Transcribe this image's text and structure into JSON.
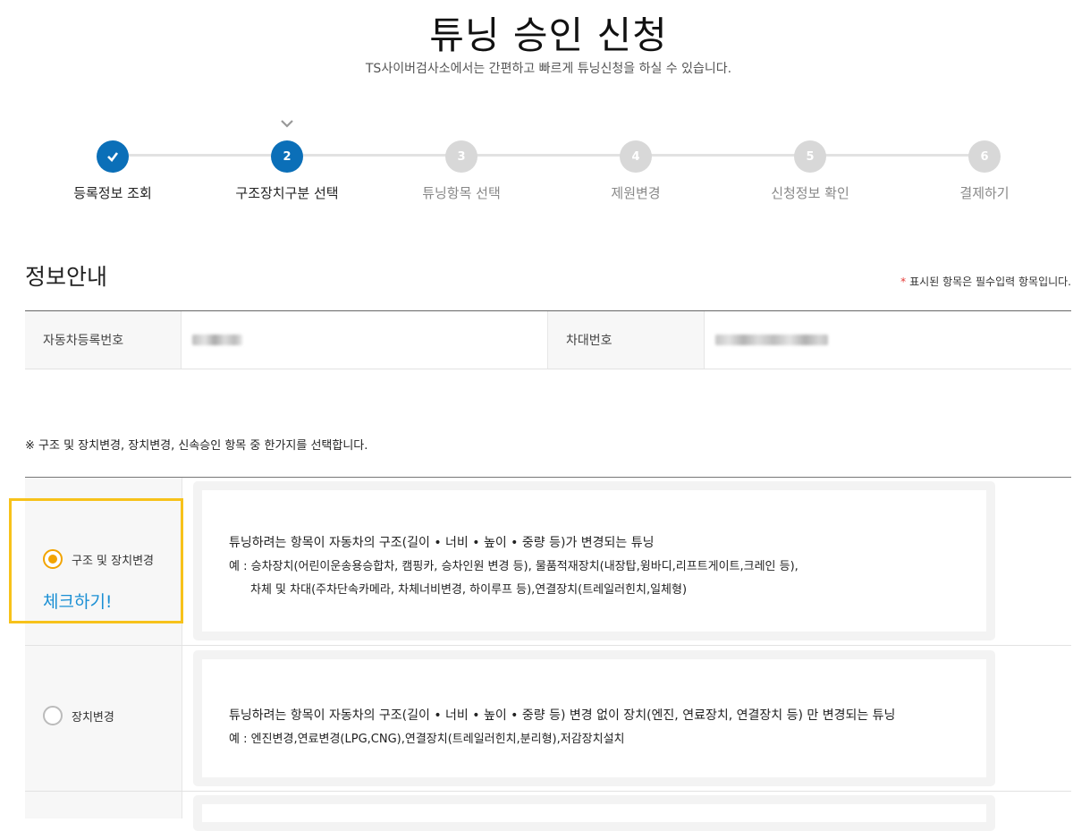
{
  "page": {
    "title": "튜닝 승인 신청",
    "subtitle": "TS사이버검사소에서는 간편하고 빠르게 튜닝신청을 하실 수 있습니다."
  },
  "stepper": {
    "current_step": 2,
    "steps": [
      {
        "number": "",
        "label": "등록정보 조회",
        "status": "done",
        "icon": "checkmark-icon"
      },
      {
        "number": "2",
        "label": "구조장치구분 선택",
        "status": "current"
      },
      {
        "number": "3",
        "label": "튜닝항목 선택",
        "status": "pending"
      },
      {
        "number": "4",
        "label": "제원변경",
        "status": "pending"
      },
      {
        "number": "5",
        "label": "신청정보 확인",
        "status": "pending"
      },
      {
        "number": "6",
        "label": "결제하기",
        "status": "pending"
      }
    ],
    "active_color": "#0b6fb8",
    "inactive_color": "#d8d8d8"
  },
  "info_section": {
    "title": "정보안내",
    "required_note_star": "*",
    "required_note": "표시된 항목은 필수입력 항목입니다.",
    "fields": [
      {
        "label": "자동차등록번호"
      },
      {
        "label": "차대번호"
      }
    ]
  },
  "selection": {
    "instruction": "※ 구조 및 장치변경, 장치변경, 신속승인 항목 중 한가지를 선택합니다.",
    "hint": "체크하기!",
    "options": [
      {
        "label": "구조 및 장치변경",
        "checked": true,
        "description": "튜닝하려는 항목이 자동차의 구조(길이 • 너비 • 높이 • 중량 등)가 변경되는 튜닝",
        "example_line1": "예 : 승차장치(어린이운송용승합차, 캠핑카, 승차인원 변경 등), 물품적재장치(내장탑,윙바디,리프트게이트,크레인 등),",
        "example_line2": "차체 및 차대(주차단속카메라, 차체너비변경, 하이루프 등),연결장치(트레일러힌치,일체형)"
      },
      {
        "label": "장치변경",
        "checked": false,
        "description": "튜닝하려는 항목이 자동차의 구조(길이 • 너비 • 높이 • 중량 등) 변경 없이 장치(엔진, 연료장치, 연결장치 등) 만 변경되는 튜닝",
        "example_line1": "예 : 엔진변경,연료변경(LPG,CNG),연결장치(트레일러힌치,분리형),저감장치설치"
      }
    ],
    "radio_checked_color": "#f2a400",
    "highlight_color": "#f7c21a",
    "hint_color": "#1a8fd4"
  }
}
